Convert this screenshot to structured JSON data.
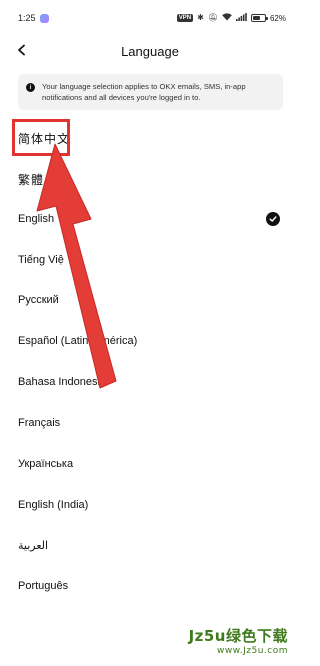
{
  "status_bar": {
    "time": "1:25",
    "vpn": "VPN",
    "battery_percent": "62%",
    "battery_level": 0.62
  },
  "header": {
    "title": "Language"
  },
  "info_banner": {
    "text": "Your language selection applies to OKX emails, SMS, in-app notifications and all devices you're logged in to."
  },
  "languages": [
    {
      "label": "简体中文",
      "selected": false
    },
    {
      "label": "繁體",
      "selected": false
    },
    {
      "label": "English",
      "selected": true
    },
    {
      "label": "Tiếng Việ",
      "selected": false
    },
    {
      "label": "Русский",
      "selected": false
    },
    {
      "label": "Español (Latinoamérica)",
      "selected": false
    },
    {
      "label": "Bahasa Indonesia",
      "selected": false
    },
    {
      "label": "Français",
      "selected": false
    },
    {
      "label": "Українська",
      "selected": false
    },
    {
      "label": "English (India)",
      "selected": false
    },
    {
      "label": "العربية",
      "selected": false
    },
    {
      "label": "Português",
      "selected": false
    }
  ],
  "annotation": {
    "highlight_color": "#e0352f",
    "arrow_color": "#e43c37"
  },
  "watermark": {
    "main": "Jz5u绿色下载",
    "url": "www.Jz5u.com"
  }
}
